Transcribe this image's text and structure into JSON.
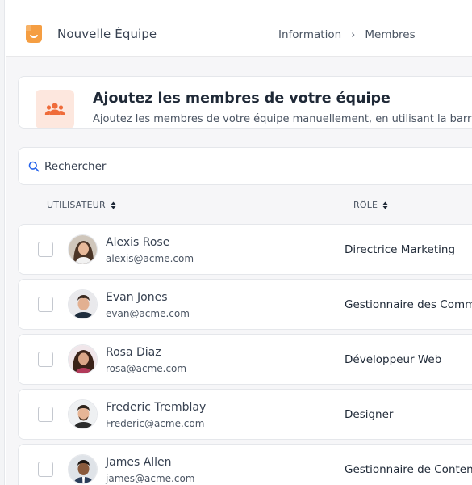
{
  "app": {
    "title": "Nouvelle Équipe",
    "brand_color": "#f59e42"
  },
  "breadcrumb": {
    "items": [
      "Information",
      "Membres"
    ],
    "separator": "›"
  },
  "header": {
    "title": "Ajoutez les membres de votre équipe",
    "subtitle": "Ajoutez les membres de votre équipe manuellement, en utilisant la barr",
    "icon": "users-icon",
    "accent": "#ef6c3a"
  },
  "search": {
    "placeholder": "Rechercher",
    "value": ""
  },
  "table": {
    "columns": [
      {
        "label": "UTILISATEUR",
        "sortable": true
      },
      {
        "label": "RÔLE",
        "sortable": true
      }
    ],
    "rows": [
      {
        "name": "Alexis Rose",
        "email": "alexis@acme.com",
        "role": "Directrice Marketing",
        "checked": false
      },
      {
        "name": "Evan Jones",
        "email": "evan@acme.com",
        "role": "Gestionnaire des Commu",
        "checked": false
      },
      {
        "name": "Rosa Diaz",
        "email": "rosa@acme.com",
        "role": "Développeur Web",
        "checked": false
      },
      {
        "name": "Frederic Tremblay",
        "email": "Frederic@acme.com",
        "role": "Designer",
        "checked": false
      },
      {
        "name": "James Allen",
        "email": "james@acme.com",
        "role": "Gestionnaire de Contenu",
        "checked": false
      }
    ]
  }
}
